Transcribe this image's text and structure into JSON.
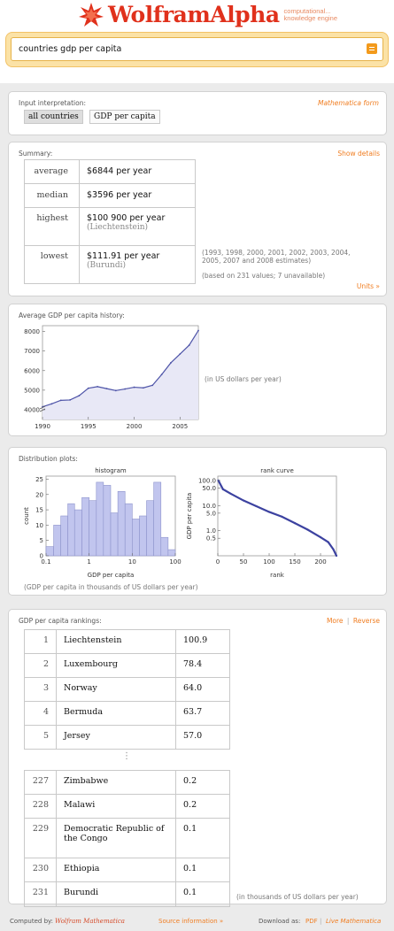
{
  "header": {
    "logo_word": "WolframAlpha",
    "logo_tag_line1": "computational...",
    "logo_tag_line2": "knowledge engine",
    "query": "countries gdp per capita",
    "accent": "#e0311c"
  },
  "input_pod": {
    "title": "Input interpretation:",
    "link": "Mathematica form",
    "chip_1": "all countries",
    "chip_2": "GDP per capita"
  },
  "summary_pod": {
    "title": "Summary:",
    "link": "Show details",
    "rows": [
      {
        "label": "average",
        "value": "$6844 per year",
        "sub": ""
      },
      {
        "label": "median",
        "value": "$3596 per year",
        "sub": ""
      },
      {
        "label": "highest",
        "value": "$100 900 per year",
        "sub": "(Liechtenstein)"
      },
      {
        "label": "lowest",
        "value": "$111.91 per year",
        "sub": "(Burundi)"
      }
    ],
    "note_years_1": "(1993, 1998, 2000, 2001, 2002, 2003, 2004,",
    "note_years_2": "2005, 2007 and 2008 estimates)",
    "note_based": "(based on 231 values; 7 unavailable)",
    "units_link": "Units »"
  },
  "history_pod": {
    "title": "Average GDP per capita history:",
    "unit_note": "(in US dollars per year)"
  },
  "distribution_pod": {
    "title": "Distribution plots:",
    "histogram_title": "histogram",
    "rank_title": "rank curve",
    "note": "(GDP per capita in thousands of US dollars per year)"
  },
  "rankings_pod": {
    "title": "GDP per capita rankings:",
    "link_more": "More",
    "link_sep": "|",
    "link_reverse": "Reverse",
    "top": [
      {
        "rank": "1",
        "country": "Liechtenstein",
        "value": "100.9"
      },
      {
        "rank": "2",
        "country": "Luxembourg",
        "value": "78.4"
      },
      {
        "rank": "3",
        "country": "Norway",
        "value": "64.0"
      },
      {
        "rank": "4",
        "country": "Bermuda",
        "value": "63.7"
      },
      {
        "rank": "5",
        "country": "Jersey",
        "value": "57.0"
      }
    ],
    "ellipsis": "⋮",
    "bottom": [
      {
        "rank": "227",
        "country": "Zimbabwe",
        "value": "0.2"
      },
      {
        "rank": "228",
        "country": "Malawi",
        "value": "0.2"
      },
      {
        "rank": "229",
        "country": "Democratic Republic of the Congo",
        "value": "0.1"
      },
      {
        "rank": "230",
        "country": "Ethiopia",
        "value": "0.1"
      },
      {
        "rank": "231",
        "country": "Burundi",
        "value": "0.1"
      }
    ],
    "unit_note": "(in thousands of US dollars per year)"
  },
  "footer": {
    "computed_by": "Computed by:",
    "computed_name": "Wolfram Mathematica",
    "source_info": "Source information »",
    "download_as": "Download as:",
    "pdf": "PDF",
    "sep": "|",
    "live": "Live Mathematica"
  },
  "chart_data": [
    {
      "type": "line",
      "title": "Average GDP per capita history:",
      "x": [
        1990,
        1991,
        1992,
        1993,
        1994,
        1995,
        1996,
        1997,
        1998,
        1999,
        2000,
        2001,
        2002,
        2003,
        2004,
        2005,
        2006,
        2007
      ],
      "values": [
        4150,
        4300,
        4480,
        4500,
        4720,
        5100,
        5180,
        5080,
        4980,
        5060,
        5150,
        5120,
        5250,
        5800,
        6400,
        6850,
        7300,
        8050
      ],
      "xticks": [
        1990,
        1995,
        2000,
        2005
      ],
      "yticks": [
        4000,
        5000,
        6000,
        7000,
        8000
      ],
      "xlim": [
        1990,
        2007
      ],
      "ylim": [
        3500,
        8300
      ],
      "ylabel": "(in US dollars per year)"
    },
    {
      "type": "bar",
      "title": "histogram",
      "xlabel": "GDP per capita",
      "ylabel": "count",
      "x_scale": "log",
      "bin_edges": [
        0.1,
        0.15,
        0.22,
        0.32,
        0.46,
        0.68,
        1.0,
        1.47,
        2.15,
        3.16,
        4.64,
        6.81,
        10,
        14.7,
        21.5,
        31.6,
        46.4,
        68.1,
        100
      ],
      "values": [
        3,
        10,
        13,
        17,
        15,
        19,
        18,
        24,
        23,
        14,
        21,
        17,
        12,
        13,
        18,
        24,
        6,
        2
      ],
      "xticks": [
        "0.1",
        "1",
        "10",
        "100"
      ],
      "yticks": [
        0,
        5,
        10,
        15,
        20,
        25
      ],
      "ylim": [
        0,
        26
      ]
    },
    {
      "type": "scatter",
      "title": "rank curve",
      "xlabel": "rank",
      "ylabel": "GDP per capita",
      "y_scale": "log",
      "x": [
        1,
        10,
        25,
        50,
        75,
        100,
        125,
        150,
        175,
        200,
        215,
        225,
        231
      ],
      "values": [
        100.9,
        45,
        30,
        16,
        9.5,
        5.6,
        3.6,
        2.0,
        1.1,
        0.55,
        0.35,
        0.18,
        0.1
      ],
      "xticks": [
        0,
        50,
        100,
        150,
        200
      ],
      "yticks": [
        "0.5",
        "1.0",
        "5.0",
        "10.0",
        "50.0",
        "100.0"
      ],
      "xlim": [
        0,
        231
      ],
      "ylim": [
        0.1,
        150
      ]
    }
  ]
}
